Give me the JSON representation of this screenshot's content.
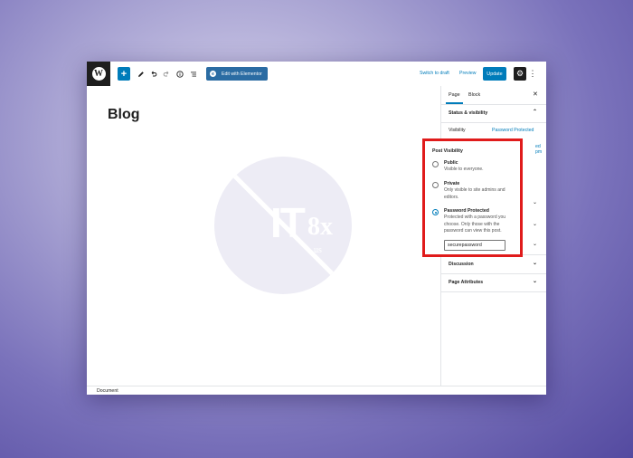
{
  "toolbar": {
    "add_label": "+",
    "edit_elementor_label": "Edit with Elementor",
    "switch_draft_label": "Switch to draft",
    "preview_label": "Preview",
    "update_label": "Update"
  },
  "canvas": {
    "page_title": "Blog",
    "watermark": {
      "main": "IT",
      "sub": "8x",
      "suffix": "us"
    }
  },
  "statusbar": {
    "label": "Document"
  },
  "sidebar": {
    "tabs": [
      {
        "label": "Page"
      },
      {
        "label": "Block"
      }
    ],
    "status_visibility": {
      "heading": "Status & visibility",
      "visibility_label": "Visibility",
      "visibility_value": "Password Protected",
      "partial_link": "ed pm"
    },
    "discussion_label": "Discussion",
    "page_attributes_label": "Page Attributes"
  },
  "popover": {
    "title": "Post Visibility",
    "options": [
      {
        "label": "Public",
        "desc": "Visible to everyone.",
        "checked": false
      },
      {
        "label": "Private",
        "desc": "Only visible to site admins and editors.",
        "checked": false
      },
      {
        "label": "Password Protected",
        "desc": "Protected with a password you choose. Only those with the password can view this post.",
        "checked": true
      }
    ],
    "password_value": "securepassword"
  },
  "colors": {
    "accent": "#007cba",
    "highlight": "#e01b1b",
    "toolbar_dark": "#1e1e1e"
  }
}
